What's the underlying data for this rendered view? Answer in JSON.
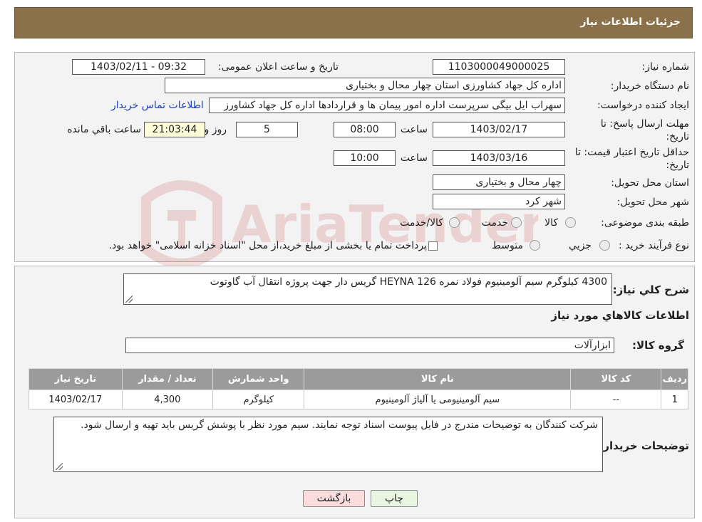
{
  "header": {
    "title": "جزئیات اطلاعات نیاز"
  },
  "form": {
    "need_number_label": "شماره نیاز:",
    "need_number": "1103000049000025",
    "announce_label": "تاریخ و ساعت اعلان عمومی:",
    "announce_value": "1403/02/11 - 09:32",
    "buyer_label": "نام دستگاه خریدار:",
    "buyer_value": "اداره کل جهاد کشاورزی استان چهار محال و بختیاری",
    "creator_label": "ایجاد کننده درخواست:",
    "creator_value": "سهراب ایل بیگی سرپرست اداره امور پیمان ها و قراردادها اداره کل جهاد کشاورز",
    "contact_link": "اطلاعات تماس خریدار",
    "deadline_label_1": "مهلت ارسال پاسخ: تا",
    "deadline_label_2": "تاریخ:",
    "deadline_date": "1403/02/17",
    "time_word": "ساعت",
    "deadline_time": "08:00",
    "days_value": "5",
    "days_word": "روز و",
    "remaining_time": "21:03:44",
    "remaining_word": "ساعت باقي مانده",
    "validity_label_1": "حداقل تاریخ اعتبار قیمت: تا",
    "validity_label_2": "تاریخ:",
    "validity_date": "1403/03/16",
    "validity_time": "10:00",
    "province_label": "استان محل تحویل:",
    "province_value": "چهار محال و بختیاری",
    "city_label": "شهر محل تحویل:",
    "city_value": "شهر کرد",
    "category_label": "طبقه بندی موضوعی:",
    "category_options": [
      "کالا",
      "خدمت",
      "کالا/خدمت"
    ],
    "process_label": "نوع فرآیند خرید :",
    "process_options": [
      "جزیي",
      "متوسط"
    ],
    "process_note": "پرداخت تمام یا بخشی از مبلغ خرید،از محل \"اسناد خزانه اسلامی\" خواهد بود."
  },
  "details": {
    "summary_label": "شرح کلي نياز:",
    "summary_value": "4300 کیلوگرم سیم آلومینیوم فولاد نمره HEYNA 126 گریس دار  جهت پروژه  انتقال آب گاوتوت",
    "goods_info_label": "اطلاعات کالاهاي مورد نياز",
    "group_label": "گروه کالا:",
    "group_value": "ابزارآلات",
    "table": {
      "headers": [
        "ردیف",
        "کد کالا",
        "نام کالا",
        "واحد شمارش",
        "تعداد / مقدار",
        "تاریخ نیاز"
      ],
      "rows": [
        [
          "1",
          "--",
          "سیم آلومینیومی یا آلیاژ آلومینیوم",
          "کیلوگرم",
          "4,300",
          "1403/02/17"
        ]
      ]
    },
    "buyer_notes_label": "توضیحات خریدار:",
    "buyer_notes_value": "شرکت کنندگان به توضیحات مندرج در فایل پیوست اسناد توجه نمایند. سیم مورد نظر با پوشش گریس باید تهیه و ارسال شود."
  },
  "buttons": {
    "print": "چاپ",
    "back": "بازگشت"
  },
  "watermark": {
    "text": "AriaTender.neT"
  },
  "colors": {
    "header_bg": "#8b7149",
    "time_bg": "#fdfbd8",
    "table_header_bg": "#9b9b9b",
    "back_btn_bg": "#fbdcdc",
    "print_btn_bg": "#e8f5e0",
    "link": "#1a3fbf"
  }
}
